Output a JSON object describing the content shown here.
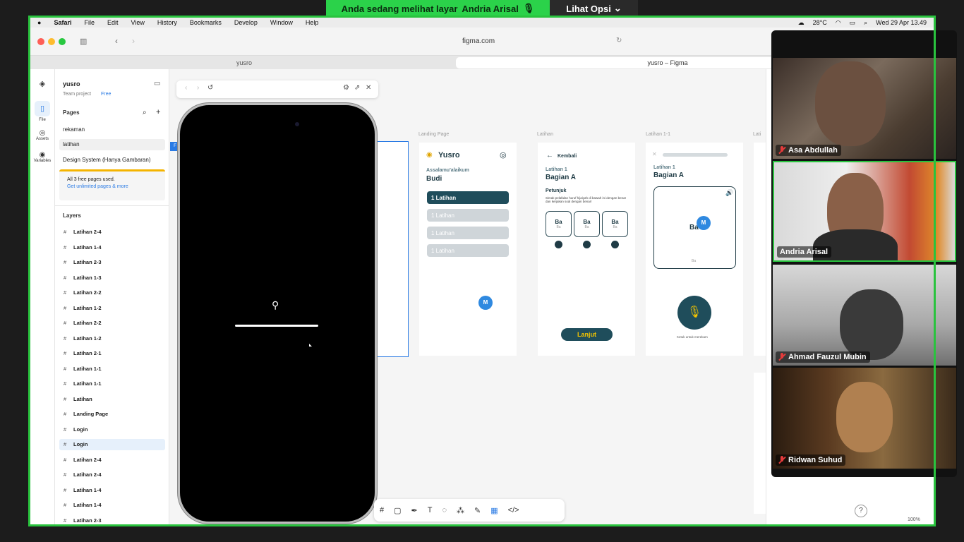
{
  "zoom": {
    "banner_text": "Anda sedang melihat layar",
    "presenter": "Andria Arisal",
    "options_label": "Lihat Opsi",
    "share_color": "#2bd24a",
    "participants": [
      {
        "name": "Asa Abdullah",
        "muted": true
      },
      {
        "name": "Andria Arisal",
        "muted": false,
        "active_speaker": true
      },
      {
        "name": "Ahmad Fauzul Mubin",
        "muted": true
      },
      {
        "name": "Ridwan Suhud",
        "muted": true
      }
    ]
  },
  "menubar": {
    "app": "Safari",
    "items": [
      "File",
      "Edit",
      "View",
      "History",
      "Bookmarks",
      "Develop",
      "Window",
      "Help"
    ],
    "weather": "28°C",
    "datetime": "Wed 29 Apr  13.49"
  },
  "browser": {
    "url": "figma.com",
    "tabs": [
      "yusro",
      "yusro – Figma"
    ]
  },
  "figma": {
    "rail": [
      "File",
      "Assets",
      "Variables"
    ],
    "project_name": "yusro",
    "team_label": "Team project",
    "plan_label": "Free",
    "pages_heading": "Pages",
    "pages": [
      "rekaman",
      "latihan",
      "Design System (Hanya Gambaran)"
    ],
    "upsell_text": "All 3 free pages used.",
    "upsell_link": "Get unlimited pages & more",
    "layers_heading": "Layers",
    "layers": [
      "Latihan 2-4",
      "Latihan 1-4",
      "Latihan 2-3",
      "Latihan 1-3",
      "Latihan 2-2",
      "Latihan 1-2",
      "Latihan 2-2",
      "Latihan 1-2",
      "Latihan 2-1",
      "Latihan 1-1",
      "Latihan 1-1",
      "Latihan",
      "Landing Page",
      "Login",
      "Login",
      "Latihan 2-4",
      "Latihan 2-4",
      "Latihan 1-4",
      "Latihan 1-4",
      "Latihan 2-3"
    ],
    "selected_layer_index": 14,
    "zoom_level": "100%",
    "help_label": "?"
  },
  "canvas": {
    "frames": [
      "Landing Page",
      "Latihan",
      "Latihan 1-1",
      "Lati"
    ],
    "landing": {
      "app_name": "Yusro",
      "greeting": "Assalamu'alaikum",
      "user": "Budi",
      "buttons": [
        "1 Latihan",
        "1 Latihan",
        "1 Latihan",
        "1 Latihan"
      ],
      "avatar_initial": "M"
    },
    "latihan": {
      "back_label": "Kembali",
      "subtitle": "Latihan 1",
      "title": "Bagian A",
      "instructions_heading": "Petunjuk",
      "instructions": "Simak pelafalan huruf hijaiyah di bawah ini dengan benar dan kerjakan soal dengan benar!",
      "cards": [
        "Ba",
        "Ba",
        "Ba"
      ],
      "card_sub": "Ba",
      "next_label": "Lanjut"
    },
    "latihan11": {
      "subtitle": "Latihan 1",
      "title": "Bagian A",
      "card_text": "Ba",
      "card_sub": "Ba",
      "record_hint": "Ketuk untuk merekam",
      "avatar_initial": "M"
    }
  }
}
